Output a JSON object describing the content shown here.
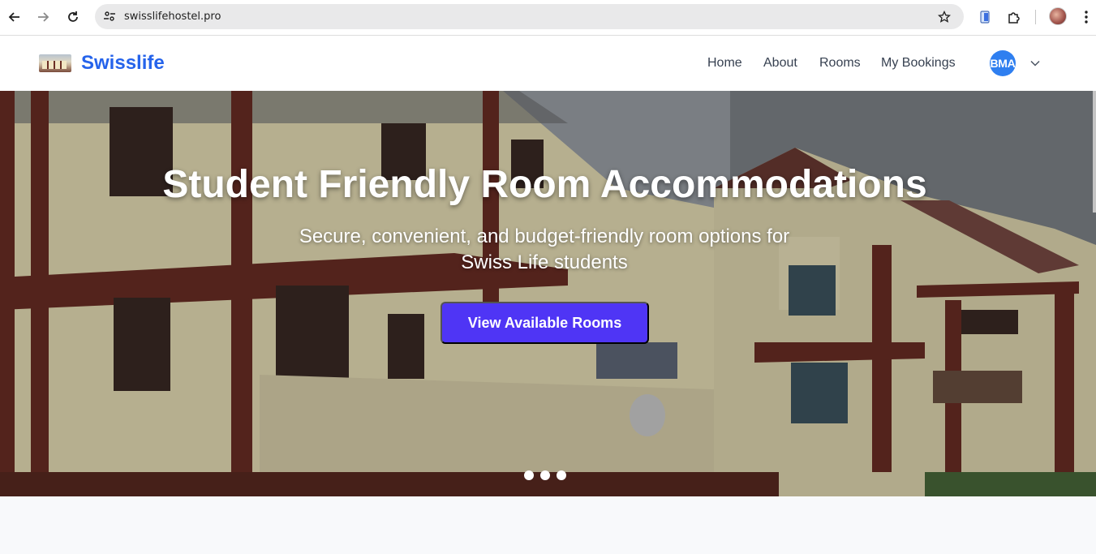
{
  "browser": {
    "url": "swisslifehostel.pro",
    "back_icon": "arrow-left-icon",
    "forward_icon": "arrow-right-icon",
    "reload_icon": "reload-icon",
    "site_info_icon": "tune-icon",
    "bookmark_icon": "star-icon"
  },
  "header": {
    "brand": "Swisslife",
    "nav": [
      {
        "label": "Home"
      },
      {
        "label": "About"
      },
      {
        "label": "Rooms"
      },
      {
        "label": "My Bookings"
      }
    ],
    "avatar_initials": "BMA"
  },
  "hero": {
    "title": "Student Friendly Room Accommodations",
    "subtitle": "Secure, convenient, and budget-friendly room options for Swiss Life students",
    "cta_label": "View Available Rooms",
    "slides_count": 3
  },
  "colors": {
    "brand": "#2563eb",
    "cta": "#4f35f5",
    "avatar": "#2f7ff0"
  }
}
